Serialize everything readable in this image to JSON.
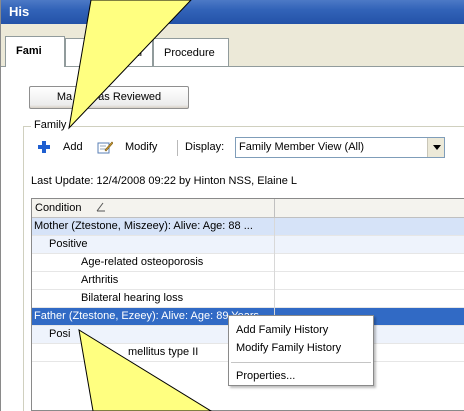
{
  "window": {
    "title": "His"
  },
  "tabs": [
    {
      "label": "Fami"
    },
    {
      "label": "cal"
    },
    {
      "label": "Procedure"
    }
  ],
  "mark_reviewed": {
    "label_left": "Ma",
    "label_right": "as Reviewed"
  },
  "family_group": {
    "label": "Family"
  },
  "toolbar": {
    "add_label": "Add",
    "modify_label": "Modify",
    "display_label": "Display:",
    "display_value": "Family Member View (All)"
  },
  "last_update": "Last Update: 12/4/2008 09:22 by Hinton NSS, Elaine L",
  "grid": {
    "column_header": "Condition",
    "rows": [
      {
        "text": "Mother (Ztestone, Miszeey): Alive: Age: 88 ...",
        "kind": "parent"
      },
      {
        "text": "Positive",
        "kind": "sub"
      },
      {
        "text": "Age-related osteoporosis",
        "kind": "leaf"
      },
      {
        "text": "Arthritis",
        "kind": "leaf"
      },
      {
        "text": "Bilateral hearing loss",
        "kind": "leaf"
      },
      {
        "text": "Father (Ztestone, Ezeey): Alive: Age: 89 Years",
        "kind": "selected"
      },
      {
        "text": "Posi",
        "kind": "sub"
      },
      {
        "text": "mellitus type II",
        "kind": "leaf"
      }
    ]
  },
  "context_menu": {
    "items": [
      {
        "label": "Add Family History"
      },
      {
        "label": "Modify Family History"
      },
      {
        "label": "Properties..."
      }
    ]
  },
  "colors": {
    "selection": "#316ac5",
    "callout": "#ffff80"
  }
}
